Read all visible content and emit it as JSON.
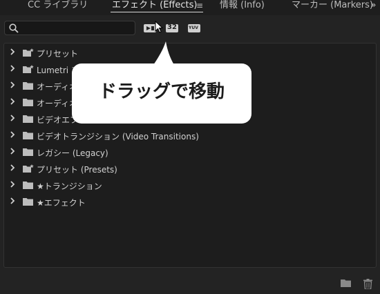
{
  "tabs": [
    {
      "label": "CC ライブラリ"
    },
    {
      "label": "エフェクト (Effects)"
    },
    {
      "label": "情報 (Info)"
    },
    {
      "label": "マーカー (Markers)"
    }
  ],
  "overflow_label": "»",
  "search": {
    "value": "",
    "placeholder": ""
  },
  "filter_buttons": [
    {
      "label": "32"
    },
    {
      "label": "YUV"
    }
  ],
  "list": {
    "items": [
      {
        "label": "プリセット"
      },
      {
        "label": "Lumetri プ"
      },
      {
        "label": "オーディオ"
      },
      {
        "label": "オーディオ"
      },
      {
        "label": "ビデオエフ"
      },
      {
        "label": "ビデオトランジション (Video Transitions)"
      },
      {
        "label": "レガシー (Legacy)"
      },
      {
        "label": "プリセット (Presets)"
      },
      {
        "label": "★トランジション"
      },
      {
        "label": "★エフェクト"
      }
    ]
  },
  "callout": {
    "text": "ドラッグで移動"
  },
  "colors": {
    "accent": "#ffffff",
    "panel": "#1d1d1d"
  },
  "icons": [
    "search-icon",
    "accelerated-effects-icon",
    "32-bit-color-icon",
    "yuv-icon",
    "chevron-right-icon",
    "folder-icon",
    "preset-folder-icon",
    "new-bin-icon",
    "trash-icon",
    "cursor-icon",
    "panel-menu-icon"
  ]
}
